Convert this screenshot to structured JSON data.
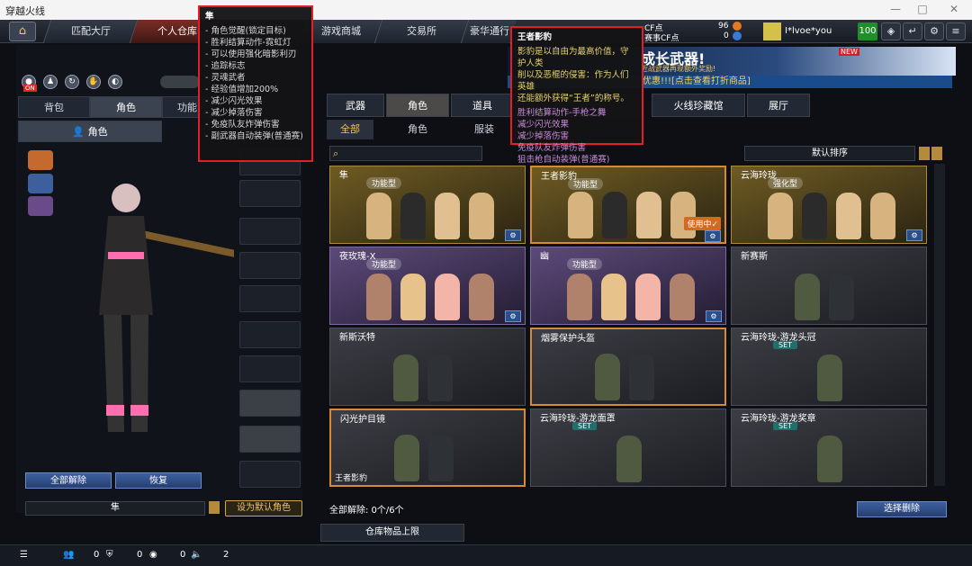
{
  "window": {
    "title": "穿越火线",
    "controls": [
      "—",
      "□",
      "✕"
    ]
  },
  "nav": {
    "tabs": [
      "匹配大厅",
      "个人仓库",
      "游戏商城",
      "交易所",
      "豪华通行"
    ],
    "cf_label": "CF点",
    "cf_value": "96",
    "tcf_label": "赛事CF点",
    "tcf_value": "0",
    "username": "I*lvoe*you",
    "level": "100",
    "icons": [
      "shield-icon",
      "exit-icon",
      "gear-icon",
      "menu-icon"
    ]
  },
  "left": {
    "tabs": [
      "背包",
      "角色",
      "功能"
    ],
    "subtab": "角色",
    "on_badge": "ON",
    "clear_all": "全部解除",
    "restore": "恢复",
    "char_name": "隼",
    "set_default": "设为默认角色"
  },
  "promo": {
    "title": "成长武器!",
    "subtitle": "近战武器再现额外奖励!",
    "new": "NEW",
    "strip": "优惠!!![点击查看打折商品]"
  },
  "main": {
    "tabs": [
      "武器",
      "角色",
      "道具",
      "",
      "火线珍藏馆",
      "展厅"
    ],
    "subtabs": [
      "全部",
      "角色",
      "服装"
    ],
    "sort": "默认排序"
  },
  "cards": [
    {
      "name": "隼",
      "grade": "功能型",
      "style": "gold",
      "inuse": ""
    },
    {
      "name": "王者影豹",
      "grade": "功能型",
      "style": "gold",
      "inuse": "使用中✓"
    },
    {
      "name": "云海玲珑",
      "grade": "强化型",
      "style": "gold",
      "inuse": ""
    },
    {
      "name": "夜玫瑰-X",
      "grade": "功能型",
      "style": "purple",
      "inuse": ""
    },
    {
      "name": "幽",
      "grade": "功能型",
      "style": "purple",
      "inuse": ""
    },
    {
      "name": "新赛斯",
      "grade": "",
      "style": "dark",
      "inuse": ""
    },
    {
      "name": "新斯沃特",
      "grade": "",
      "style": "dark",
      "inuse": ""
    },
    {
      "name": "烟雾保护头盔",
      "grade": "",
      "style": "dark",
      "inuse": ""
    },
    {
      "name": "云海玲珑-游龙头冠",
      "grade": "SET",
      "style": "dark",
      "inuse": ""
    },
    {
      "name": "闪光护目镜",
      "grade": "",
      "style": "dark",
      "inuse": "",
      "owner": "王者影豹"
    },
    {
      "name": "云海玲珑-游龙面罩",
      "grade": "SET",
      "style": "dark",
      "inuse": ""
    },
    {
      "name": "云海玲珑-游龙奖章",
      "grade": "SET",
      "style": "dark",
      "inuse": ""
    }
  ],
  "bottom": {
    "clear_count": "全部解除: 0个/6个",
    "select_clear": "选择删除",
    "storage": "仓库物品上限"
  },
  "status": {
    "a": "0",
    "b": "0",
    "c": "0",
    "d": "2"
  },
  "tip_left": {
    "title": "隼",
    "lines": [
      "- 角色觉醒(锁定目标)",
      "- 胜利结算动作-霓虹灯",
      "- 可以使用强化暗影利刃",
      "- 追踪标志",
      "- 灵魂武者",
      "- 经验值增加200%",
      "- 减少闪光效果",
      "- 减少掉落伤害",
      "- 免疫队友炸弹伤害",
      "- 副武器自动装弹(普通赛)"
    ]
  },
  "tip_right": {
    "title": "王者影豹",
    "desc": [
      "影豹是以自由为最高价值，守护人类",
      "削以及恶棍的侵害：作为人们英雄",
      "还能额外获得“王者”的称号。"
    ],
    "lines": [
      "胜利结算动作-手枪之舞",
      "减少闪光效果",
      "减少掉落伤害",
      "免疫队友炸弹伤害",
      "狙击枪自动装弹(普通赛)"
    ]
  }
}
